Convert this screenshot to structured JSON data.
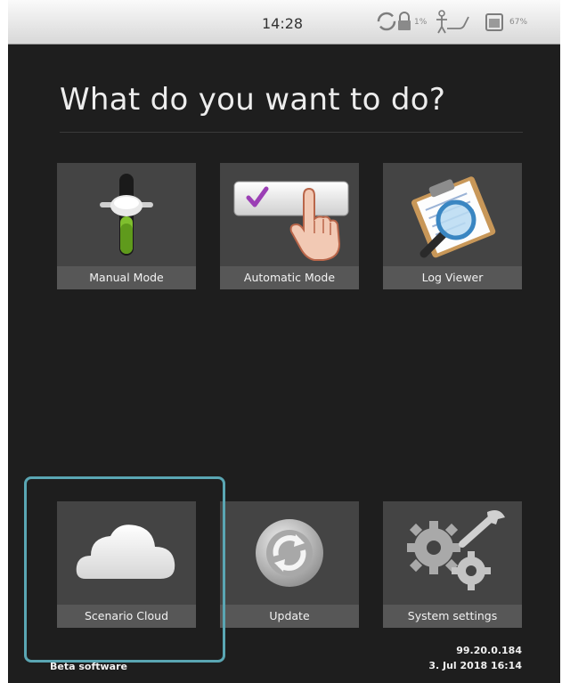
{
  "status_bar": {
    "time": "14:28",
    "wifi_percent": "1%",
    "battery_percent": "67%",
    "icons": [
      "sync-icon",
      "lock-icon",
      "connection-icon",
      "battery-icon"
    ]
  },
  "title": "What do you want to do?",
  "tiles": [
    {
      "label": "Manual Mode",
      "icon": "slider-icon"
    },
    {
      "label": "Automatic Mode",
      "icon": "touch-check-icon"
    },
    {
      "label": "Log Viewer",
      "icon": "clipboard-magnifier-icon"
    },
    {
      "label": "Scenario Cloud",
      "icon": "cloud-icon"
    },
    {
      "label": "Update",
      "icon": "refresh-icon"
    },
    {
      "label": "System settings",
      "icon": "gears-wrench-icon"
    }
  ],
  "footer": {
    "beta": "Beta software",
    "version": "99.20.0.184",
    "date": "3. Jul 2018 16:14"
  },
  "colors": {
    "background": "#1e1e1e",
    "tile": "#444444",
    "label_bar": "#575757",
    "highlight": "#5aa6b3"
  }
}
